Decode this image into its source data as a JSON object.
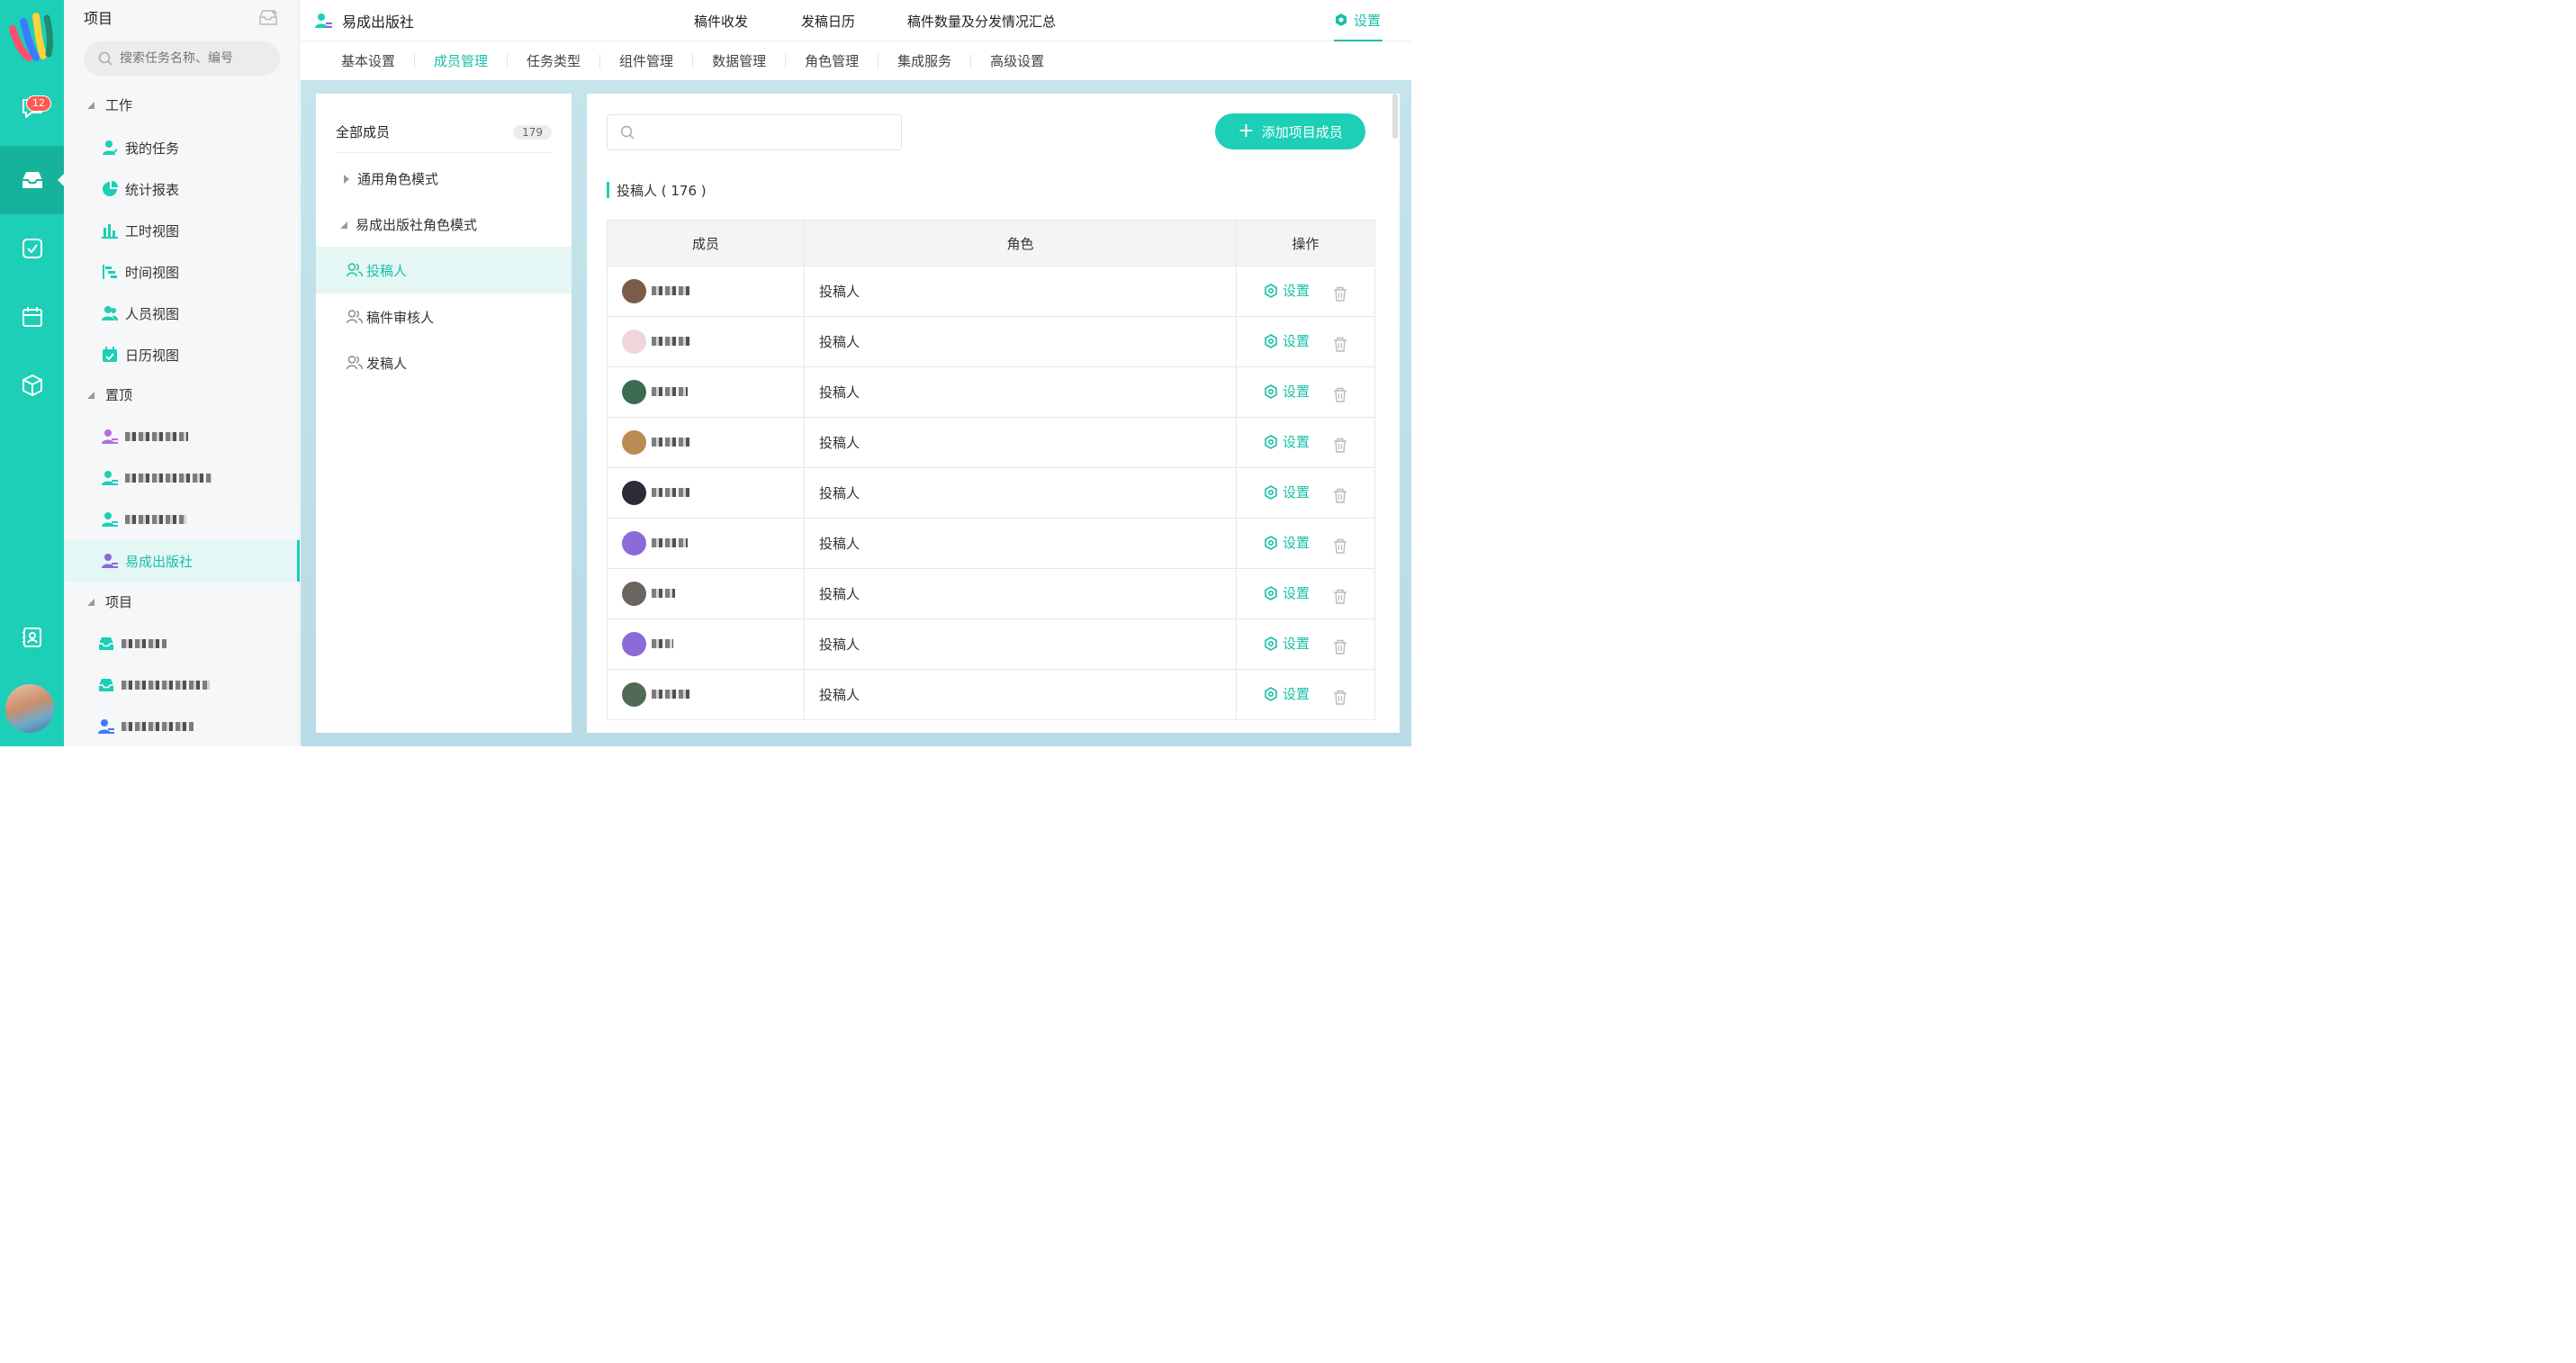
{
  "rail": {
    "chat_badge": "12",
    "icons": [
      "chat-icon",
      "inbox-icon",
      "task-check-icon",
      "calendar-icon",
      "cube-icon",
      "contacts-icon"
    ]
  },
  "nav": {
    "header_title": "项目",
    "search_placeholder": "搜索任务名称、编号",
    "sections": {
      "work": "工作",
      "pinned": "置顶",
      "projects": "项目"
    },
    "work_items": [
      "我的任务",
      "统计报表",
      "工时视图",
      "时间视图",
      "人员视图",
      "日历视图"
    ],
    "pinned_selected": "易成出版社"
  },
  "header": {
    "title": "易成出版社",
    "menu": [
      "稿件收发",
      "发稿日历",
      "稿件数量及分发情况汇总"
    ],
    "settings": "设置"
  },
  "tabs": [
    "基本设置",
    "成员管理",
    "任务类型",
    "组件管理",
    "数据管理",
    "角色管理",
    "集成服务",
    "高级设置"
  ],
  "roles": {
    "all_members": "全部成员",
    "all_count": "179",
    "group_general": "通用角色模式",
    "group_publisher": "易成出版社角色模式",
    "items": [
      "投稿人",
      "稿件审核人",
      "发稿人"
    ]
  },
  "members": {
    "search_placeholder": "",
    "add_button": "添加项目成员",
    "group_title": "投稿人 ( 176 )",
    "columns": [
      "成员",
      "角色",
      "操作"
    ],
    "rows": [
      {
        "role": "投稿人",
        "action": "设置"
      },
      {
        "role": "投稿人",
        "action": "设置"
      },
      {
        "role": "投稿人",
        "action": "设置"
      },
      {
        "role": "投稿人",
        "action": "设置"
      },
      {
        "role": "投稿人",
        "action": "设置"
      },
      {
        "role": "投稿人",
        "action": "设置"
      },
      {
        "role": "投稿人",
        "action": "设置"
      },
      {
        "role": "投稿人",
        "action": "设置"
      },
      {
        "role": "投稿人",
        "action": "设置"
      }
    ]
  },
  "colors": {
    "accent": "#1ccfb6",
    "accent_text": "#19bfa8"
  }
}
